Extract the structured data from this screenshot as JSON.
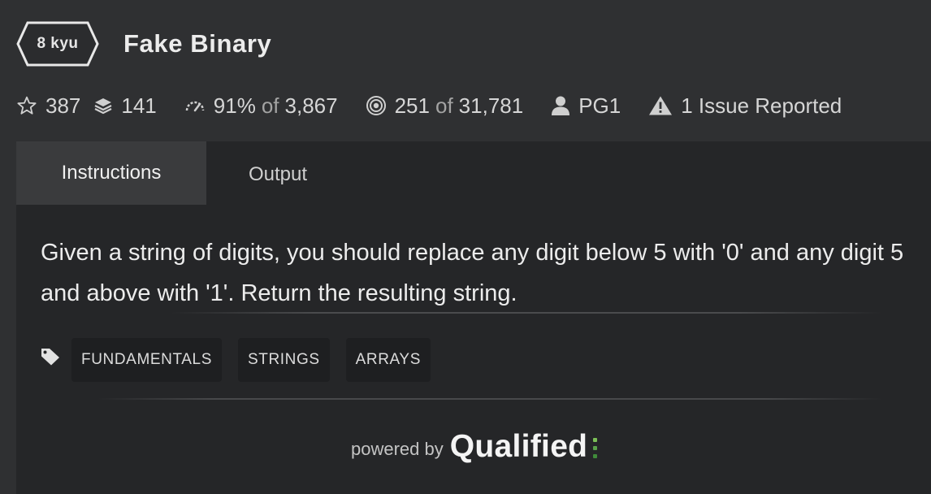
{
  "header": {
    "kyu": "8 kyu",
    "title": "Fake Binary"
  },
  "stats": {
    "stars": "387",
    "collections": "141",
    "satisfaction_pct": "91%",
    "satisfaction_of": "of",
    "satisfaction_votes": "3,867",
    "completed": "251",
    "completed_of": "of",
    "completed_total": "31,781",
    "author": "PG1",
    "issues": "1 Issue Reported"
  },
  "tabs": {
    "instructions": "Instructions",
    "output": "Output"
  },
  "description": "Given a string of digits, you should replace any digit below 5 with '0' and any digit 5 and above with '1'. Return the resulting string.",
  "tags": [
    "FUNDAMENTALS",
    "STRINGS",
    "ARRAYS"
  ],
  "footer": {
    "powered_by": "powered by",
    "brand": "Qualified"
  },
  "colors": {
    "background": "#2f3032",
    "panel": "#252628",
    "active_tab": "#3a3b3d",
    "tag_bg": "#1e1f21",
    "brand_green": "#6fb34a"
  },
  "icons": [
    "star-icon",
    "collections-icon",
    "satisfaction-gauge-icon",
    "target-icon",
    "user-icon",
    "warning-icon",
    "tag-icon"
  ]
}
